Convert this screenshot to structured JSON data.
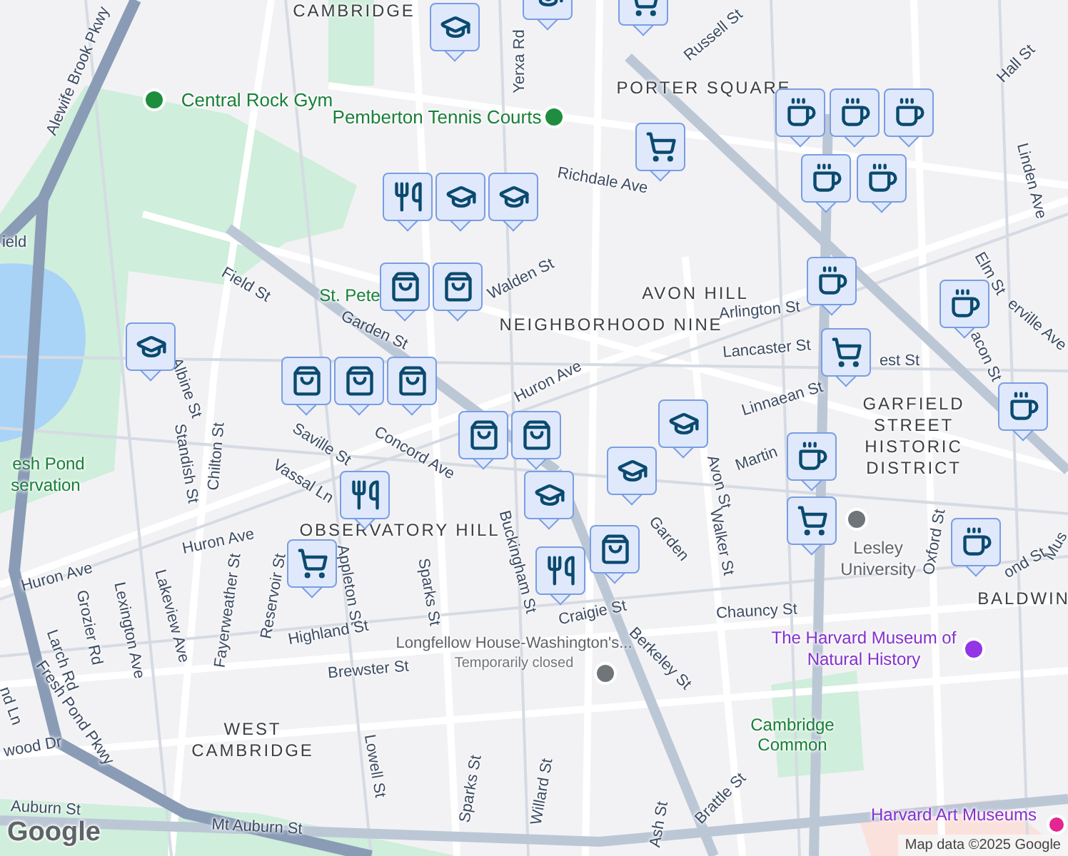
{
  "labels": [
    {
      "text": "CAMBRIDGE",
      "kind": "area"
    },
    {
      "text": "Russell St",
      "kind": "street"
    },
    {
      "text": "Alewife Brook Pkwy",
      "kind": "street"
    },
    {
      "text": "Yerxa Rd",
      "kind": "street"
    },
    {
      "text": "Hall St",
      "kind": "street"
    },
    {
      "text": "PORTER SQUARE",
      "kind": "area"
    },
    {
      "text": "Central Rock Gym",
      "kind": "park_poi"
    },
    {
      "text": "Pemberton Tennis Courts",
      "kind": "park_poi"
    },
    {
      "text": "Richdale Ave",
      "kind": "street"
    },
    {
      "text": "Linden Ave",
      "kind": "street"
    },
    {
      "text": "ield",
      "kind": "street"
    },
    {
      "text": "Elm St",
      "kind": "street"
    },
    {
      "text": "Walden St",
      "kind": "street"
    },
    {
      "text": "Field St",
      "kind": "street"
    },
    {
      "text": "AVON HILL",
      "kind": "area"
    },
    {
      "text": "St. Pete",
      "kind": "park"
    },
    {
      "text": "Arlington St",
      "kind": "street"
    },
    {
      "text": "NEIGHBORHOOD NINE",
      "kind": "area"
    },
    {
      "text": "erville Ave",
      "kind": "street"
    },
    {
      "text": "Garden St",
      "kind": "street"
    },
    {
      "text": "Lancaster St",
      "kind": "street"
    },
    {
      "text": "acon St",
      "kind": "street"
    },
    {
      "text": "est St",
      "kind": "street"
    },
    {
      "text": "Huron Ave",
      "kind": "street"
    },
    {
      "text": "Albine St",
      "kind": "street"
    },
    {
      "text": "Linnaean St",
      "kind": "street"
    },
    {
      "text": "Saville St",
      "kind": "street"
    },
    {
      "text": "Concord Ave",
      "kind": "street"
    },
    {
      "text": "Martin",
      "kind": "street"
    },
    {
      "text": "esh Pond",
      "kind": "park"
    },
    {
      "text": "Standish St",
      "kind": "street"
    },
    {
      "text": "Chilton St",
      "kind": "street"
    },
    {
      "text": "Avon St",
      "kind": "street"
    },
    {
      "text": "Vassal Ln",
      "kind": "street"
    },
    {
      "text": "servation",
      "kind": "park"
    },
    {
      "text": "GARFIELD STREET HISTORIC DISTRICT",
      "kind": "area"
    },
    {
      "text": "Garden",
      "kind": "street"
    },
    {
      "text": "OBSERVATORY HILL",
      "kind": "area"
    },
    {
      "text": "Huron Ave",
      "kind": "street"
    },
    {
      "text": "Walker St",
      "kind": "street"
    },
    {
      "text": "Oxford St",
      "kind": "street"
    },
    {
      "text": "Mus",
      "kind": "street"
    },
    {
      "text": "Lesley University",
      "kind": "school_poi"
    },
    {
      "text": "ond St",
      "kind": "street"
    },
    {
      "text": "Buckingham St",
      "kind": "street"
    },
    {
      "text": "Huron Ave",
      "kind": "street"
    },
    {
      "text": "Appleton St",
      "kind": "street"
    },
    {
      "text": "Sparks St",
      "kind": "street"
    },
    {
      "text": "Reservoir St",
      "kind": "street"
    },
    {
      "text": "BALDWIN",
      "kind": "area"
    },
    {
      "text": "Fayerweather St",
      "kind": "street"
    },
    {
      "text": "Chauncy St",
      "kind": "street"
    },
    {
      "text": "Craigie St",
      "kind": "street"
    },
    {
      "text": "Lakeview Ave",
      "kind": "street"
    },
    {
      "text": "Grozier Rd",
      "kind": "street"
    },
    {
      "text": "Lexington Ave",
      "kind": "street"
    },
    {
      "text": "Highland St",
      "kind": "street"
    },
    {
      "text": "Larch Rd",
      "kind": "street"
    },
    {
      "text": "Longfellow House-Washington's...",
      "kind": "landmark_poi"
    },
    {
      "text": "Temporarily closed",
      "kind": "note"
    },
    {
      "text": "Berkeley St",
      "kind": "street"
    },
    {
      "text": "The Harvard Museum of Natural History",
      "kind": "museum_poi"
    },
    {
      "text": "Brewster St",
      "kind": "street"
    },
    {
      "text": "nd Ln",
      "kind": "street"
    },
    {
      "text": "Fresh Pond Pkwy",
      "kind": "street"
    },
    {
      "text": "WEST CAMBRIDGE",
      "kind": "area"
    },
    {
      "text": "Cambridge Common",
      "kind": "park"
    },
    {
      "text": "wood Dr",
      "kind": "street"
    },
    {
      "text": "Lowell St",
      "kind": "street"
    },
    {
      "text": "Sparks St",
      "kind": "street"
    },
    {
      "text": "Willard St",
      "kind": "street"
    },
    {
      "text": "Brattle St",
      "kind": "street"
    },
    {
      "text": "Auburn St",
      "kind": "street"
    },
    {
      "text": "Harvard Art Museums",
      "kind": "art_poi"
    },
    {
      "text": "Ash St",
      "kind": "street"
    },
    {
      "text": "Mt Auburn St",
      "kind": "street"
    }
  ],
  "markers": [
    {
      "kind": "school"
    },
    {
      "kind": "school"
    },
    {
      "kind": "grocery"
    },
    {
      "kind": "grocery"
    },
    {
      "kind": "cafe"
    },
    {
      "kind": "cafe"
    },
    {
      "kind": "cafe"
    },
    {
      "kind": "cafe"
    },
    {
      "kind": "cafe"
    },
    {
      "kind": "cafe"
    },
    {
      "kind": "grocery"
    },
    {
      "kind": "cafe"
    },
    {
      "kind": "cafe"
    },
    {
      "kind": "cafe"
    },
    {
      "kind": "grocery"
    },
    {
      "kind": "cafe"
    },
    {
      "kind": "school"
    },
    {
      "kind": "school"
    },
    {
      "kind": "shop"
    },
    {
      "kind": "restaurant"
    },
    {
      "kind": "shop"
    },
    {
      "kind": "shop"
    },
    {
      "kind": "school"
    },
    {
      "kind": "shop"
    },
    {
      "kind": "shop"
    },
    {
      "kind": "shop"
    },
    {
      "kind": "restaurant"
    },
    {
      "kind": "grocery"
    },
    {
      "kind": "school"
    },
    {
      "kind": "restaurant"
    },
    {
      "kind": "school"
    },
    {
      "kind": "school"
    },
    {
      "kind": "shop"
    },
    {
      "kind": "shop"
    }
  ],
  "logo": "Google",
  "attribution": "Map data ©2025 Google"
}
